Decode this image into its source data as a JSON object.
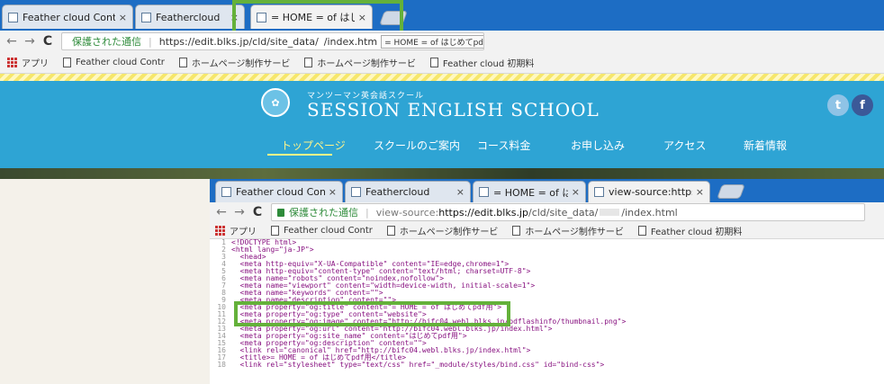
{
  "browser1": {
    "tabs": [
      {
        "title": "Feather cloud Control Pa"
      },
      {
        "title": "Feathercloud"
      },
      {
        "title": "= HOME = of はじめてpd"
      }
    ],
    "tab_close_glyph": "×",
    "nav": {
      "back": "←",
      "forward": "→",
      "reload": "C"
    },
    "security_label": "保護された通信",
    "url": "https://edit.blks.jp/cld/site_data/",
    "url_tail": "/index.htm",
    "tooltip": "= HOME = of はじめてpdf用",
    "bookmarks": [
      {
        "label": "アプリ",
        "icon": "apps-icon"
      },
      {
        "label": "Feather cloud Contr",
        "icon": "page-icon"
      },
      {
        "label": "ホームページ制作サービ",
        "icon": "page-icon"
      },
      {
        "label": "ホームページ制作サービ",
        "icon": "page-icon"
      },
      {
        "label": "Feather cloud 初期料",
        "icon": "page-icon"
      }
    ]
  },
  "site": {
    "logo_subtitle": "マンツーマン英会話スクール",
    "logo_title": "SESSION ENGLISH SCHOOL",
    "menu": [
      "トップページ",
      "スクールのご案内",
      "コース料金",
      "お申し込み",
      "アクセス",
      "新着情報"
    ],
    "social": [
      {
        "name": "twitter-icon",
        "glyph": "t",
        "color": "#8fc3e6"
      },
      {
        "name": "facebook-icon",
        "glyph": "f",
        "color": "#3b5998"
      }
    ],
    "accent_color": "#2ea4d4",
    "active_menu_color": "#fff48a"
  },
  "browser2": {
    "tabs": [
      {
        "title": "Feather cloud Control Pa"
      },
      {
        "title": "Feathercloud"
      },
      {
        "title": "= HOME = of はじめてpdf"
      },
      {
        "title": "view-source:https://edit"
      }
    ],
    "security_label": "保護された通信",
    "url_prefix": "view-source:",
    "url_host": "https://edit.blks.jp",
    "url_path": "/cld/site_data/",
    "url_tail": "/index.html",
    "bookmarks": [
      {
        "label": "アプリ"
      },
      {
        "label": "Feather cloud Contr"
      },
      {
        "label": "ホームページ制作サービ"
      },
      {
        "label": "ホームページ制作サービ"
      },
      {
        "label": "Feather cloud 初期料"
      }
    ],
    "source_lines": [
      {
        "n": "1",
        "code": "<!DOCTYPE html>"
      },
      {
        "n": "2",
        "code": "<html lang=\"ja-JP\">"
      },
      {
        "n": "3",
        "code": "  <head>"
      },
      {
        "n": "4",
        "code": "  <meta http-equiv=\"X-UA-Compatible\" content=\"IE=edge,chrome=1\">"
      },
      {
        "n": "5",
        "code": "  <meta http-equiv=\"content-type\" content=\"text/html; charset=UTF-8\">"
      },
      {
        "n": "6",
        "code": "  <meta name=\"robots\" content=\"noindex,nofollow\">"
      },
      {
        "n": "7",
        "code": "  <meta name=\"viewport\" content=\"width=device-width, initial-scale=1\">"
      },
      {
        "n": "8",
        "code": "  <meta name=\"keywords\" content=\"\">"
      },
      {
        "n": "9",
        "code": "  <meta name=\"description\" content=\"\">"
      },
      {
        "n": "10",
        "code": "  <meta property=\"og:title\" content=\"= HOME = of はじめてpdf用\">"
      },
      {
        "n": "11",
        "code": "  <meta property=\"og:type\" content=\"website\">"
      },
      {
        "n": "12",
        "code": "  <meta property=\"og:image\" content=\"http://bifc04.webl.blks.jp/bdflashinfo/thumbnail.png\">"
      },
      {
        "n": "13",
        "code": "  <meta property=\"og:url\" content=\"http://bifc04.webl.blks.jp/index.html\">"
      },
      {
        "n": "14",
        "code": "  <meta property=\"og:site_name\" content=\"はじめてpdf用\">"
      },
      {
        "n": "15",
        "code": "  <meta property=\"og:description\" content=\"\">"
      },
      {
        "n": "16",
        "code": "  <link rel=\"canonical\" href=\"http://bifc04.webl.blks.jp/index.html\">"
      },
      {
        "n": "17",
        "code": "  <title>= HOME = of はじめてpdf用</title>"
      },
      {
        "n": "18",
        "code": "  <link rel=\"stylesheet\" type=\"text/css\" href=\"_module/styles/bind.css\" id=\"bind-css\">"
      }
    ]
  },
  "highlight_color": "#64b13a"
}
